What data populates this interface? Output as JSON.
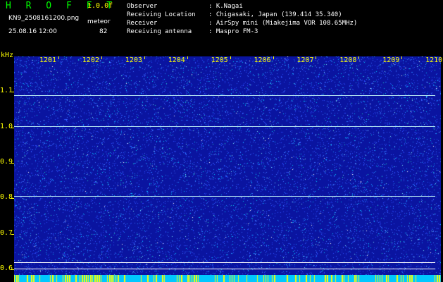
{
  "header": {
    "app_title": "H R O F F T",
    "version": "1.0.0f",
    "filename": "KN9_2508161200.png",
    "meteor_label": "meteor",
    "datetime": "25.08.16 12:00",
    "meteor_count": "82"
  },
  "info": [
    {
      "label": "Observer",
      "value": ": K.Nagai"
    },
    {
      "label": "Receiving Location",
      "value": ": Chigasaki, Japan (139.414 35.340)"
    },
    {
      "label": "Receiver",
      "value": ": AirSpy mini (Miakejima VOR 108.65MHz)"
    },
    {
      "label": "Receiving antenna",
      "value": ": Maspro FM-3"
    }
  ],
  "chart_data": {
    "type": "heatmap",
    "ylabel": "kHz",
    "x_ticks": [
      "1201",
      "1202",
      "1203",
      "1204",
      "1205",
      "1206",
      "1207",
      "1208",
      "1209",
      "1210"
    ],
    "y_ticks": [
      "1.1",
      "1.0",
      "0.9",
      "0.8",
      "0.7",
      "0.6"
    ],
    "ylim": [
      0.58,
      1.2
    ],
    "horizontal_lines_khz": [
      {
        "value": 1.09,
        "color": "#b0e0f0"
      },
      {
        "value": 1.003,
        "color": "#b0e0f0"
      },
      {
        "value": 0.807,
        "color": "#b0e0f0"
      },
      {
        "value": 0.619,
        "color": "#ffffff"
      },
      {
        "value": 0.602,
        "color": "#ffffff"
      }
    ]
  },
  "colors": {
    "background": "#0a14a0",
    "tick_text": "#ffff00",
    "title": "#00ff00"
  }
}
